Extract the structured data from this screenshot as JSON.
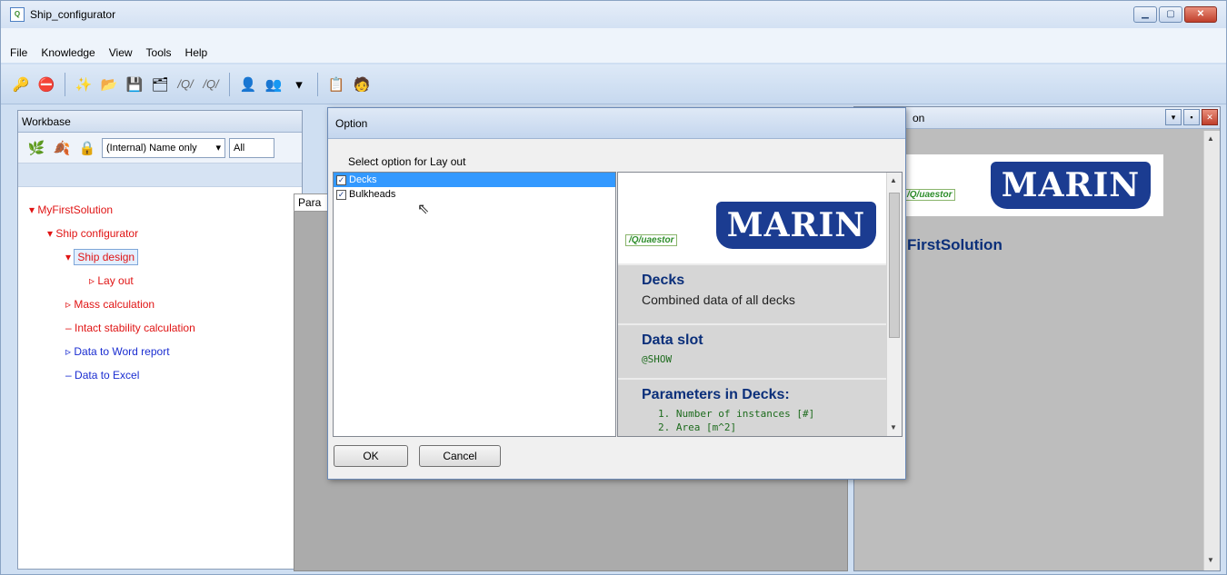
{
  "window": {
    "title": "Ship_configurator",
    "icon": "app-q-icon"
  },
  "menu": {
    "items": [
      "File",
      "Knowledge",
      "View",
      "Tools",
      "Help"
    ]
  },
  "toolbar": {
    "q_glyph_1": "/Q/",
    "q_glyph_2": "/Q/"
  },
  "workbase": {
    "title": "Workbase",
    "combo_value": "(Internal) Name only",
    "filter_value": "All",
    "center_tab": "Para",
    "tree": [
      {
        "label": "MyFirstSolution",
        "color": "#e01414"
      },
      {
        "label": "Ship configurator",
        "color": "#e01414"
      },
      {
        "label": "Ship design",
        "color": "#e01414",
        "selected": true
      },
      {
        "label": "Lay out",
        "color": "#e01414"
      },
      {
        "label": "Mass calculation",
        "color": "#e01414"
      },
      {
        "label": "Intact stability calculation",
        "color": "#e01414"
      },
      {
        "label": "Data to Word report",
        "color": "#1a2dd1"
      },
      {
        "label": "Data to Excel",
        "color": "#1a2dd1"
      }
    ]
  },
  "right_panel": {
    "title_fragment": "on",
    "solution_fragment": "FirstSolution",
    "logo_text": "MARIN",
    "quaestor_text": "/Q/uaestor"
  },
  "dialog": {
    "title": "Option",
    "prompt": "Select option for Lay out",
    "options": [
      {
        "label": "Decks",
        "checked": true,
        "selected": true
      },
      {
        "label": "Bulkheads",
        "checked": true,
        "selected": false
      }
    ],
    "info": {
      "logo_text": "MARIN",
      "quaestor_text": "/Q/uaestor",
      "item_title": "Decks",
      "item_desc": "Combined data of all decks",
      "slot_title": "Data slot",
      "slot_value": "@SHOW",
      "params_title": "Parameters in Decks:",
      "params": [
        "1. Number of instances [#]",
        "2. Area [m^2]"
      ]
    },
    "ok_label": "OK",
    "cancel_label": "Cancel"
  }
}
